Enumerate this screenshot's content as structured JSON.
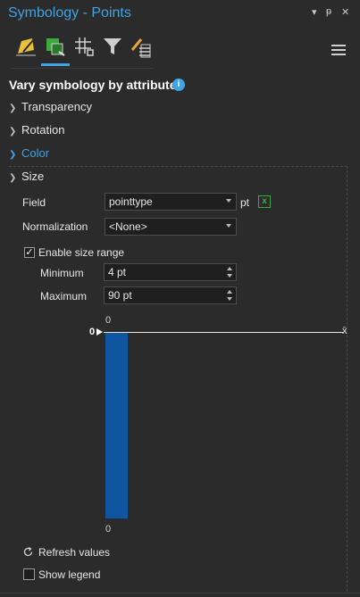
{
  "window": {
    "title": "Symbology - Points"
  },
  "titlebar_buttons": {
    "menu_icon": "chevron-down-icon",
    "pin_icon": "pin-icon",
    "close_icon": "close-icon"
  },
  "tabs": [
    {
      "name": "primary-symbology",
      "icon": "pencil-brush-icon",
      "active": false
    },
    {
      "name": "vary-symbology",
      "icon": "vary-symbology-icon",
      "active": true
    },
    {
      "name": "symbol-layers",
      "icon": "hash-layers-icon",
      "active": false
    },
    {
      "name": "filter",
      "icon": "funnel-icon",
      "active": false
    },
    {
      "name": "symbol-settings",
      "icon": "brush-list-icon",
      "active": false
    }
  ],
  "heading": "Vary symbology by attribute",
  "sections": {
    "transparency": "Transparency",
    "rotation": "Rotation",
    "color": "Color",
    "size": "Size"
  },
  "size": {
    "field_label": "Field",
    "field_value": "pointtype",
    "field_unit": "pt",
    "normalization_label": "Normalization",
    "normalization_value": "<None>",
    "enable_size_range_label": "Enable size range",
    "enable_size_range_checked": true,
    "minimum_label": "Minimum",
    "minimum_value": "4 pt",
    "maximum_label": "Maximum",
    "maximum_value": "90 pt",
    "histogram": {
      "top_value": "0",
      "axis_marker": "0",
      "axis_end": "x̄",
      "bottom_value": "0"
    },
    "refresh_label": "Refresh values",
    "show_legend_label": "Show legend",
    "show_legend_checked": false
  },
  "colors": {
    "accent": "#3fa3e6",
    "bar": "#0f55a0",
    "background": "#2b2b2b"
  }
}
